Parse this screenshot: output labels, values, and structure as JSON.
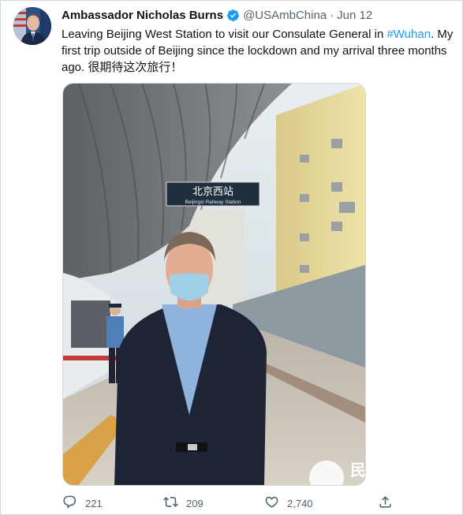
{
  "tweet": {
    "author_name": "Ambassador Nicholas Burns",
    "handle": "@USAmbChina",
    "separator": "·",
    "date": "Jun 12",
    "text_before": "Leaving Beijing West Station to visit our Consulate General in ",
    "hashtag": "#Wuhan",
    "text_after": ".  My first trip outside of Beijing since the lockdown and my arrival three months ago. 很期待这次旅行！",
    "photo": {
      "station_sign_cn": "北京西站",
      "station_sign_en": "Beijingxi Railway Station",
      "watermark": "民"
    },
    "stats": {
      "replies": "221",
      "retweets": "209",
      "likes": "2,740"
    }
  },
  "colors": {
    "accent": "#1d9bf0",
    "secondary_text": "#536471",
    "border": "#cfd9de"
  }
}
